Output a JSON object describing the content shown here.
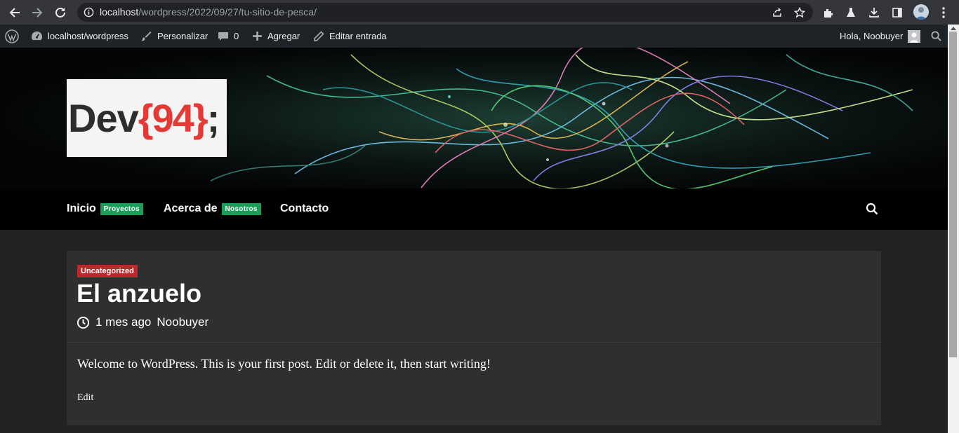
{
  "browser": {
    "url_host": "localhost",
    "url_path": "/wordpress/2022/09/27/tu-sitio-de-pesca/"
  },
  "adminbar": {
    "site": "localhost/wordpress",
    "customize": "Personalizar",
    "comments_count": "0",
    "add_new": "Agregar",
    "edit_post": "Editar entrada",
    "greeting": "Hola, Noobuyer"
  },
  "header": {
    "logo_dev": "Dev",
    "logo_num": "{94}",
    "logo_semi": ";"
  },
  "menu": {
    "items": [
      {
        "label": "Inicio",
        "badge": "Proyectos"
      },
      {
        "label": "Acerca de",
        "badge": "Nosotros"
      },
      {
        "label": "Contacto",
        "badge": ""
      }
    ]
  },
  "post": {
    "category": "Uncategorized",
    "title": "El anzuelo",
    "time_ago": "1 mes ago",
    "author": "Noobuyer",
    "body": "Welcome to WordPress. This is your first post. Edit or delete it, then start writing!",
    "edit_label": "Edit"
  },
  "colors": {
    "badge_green": "#19a058",
    "category_red": "#c0272d",
    "logo_red": "#e53935"
  }
}
